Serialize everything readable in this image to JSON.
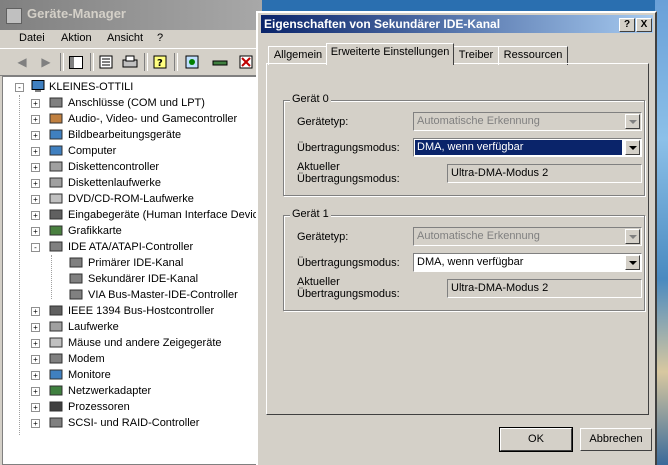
{
  "device_manager": {
    "title": "Geräte-Manager",
    "menu": [
      "Datei",
      "Aktion",
      "Ansicht",
      "?"
    ],
    "tree": {
      "root": "KLEINES-OTTILI",
      "items": [
        {
          "label": "Anschlüsse (COM und LPT)",
          "expand": "+",
          "level": 1
        },
        {
          "label": "Audio-, Video- und Gamecontroller",
          "expand": "+",
          "level": 1
        },
        {
          "label": "Bildbearbeitungsgeräte",
          "expand": "+",
          "level": 1
        },
        {
          "label": "Computer",
          "expand": "+",
          "level": 1
        },
        {
          "label": "Diskettencontroller",
          "expand": "+",
          "level": 1
        },
        {
          "label": "Diskettenlaufwerke",
          "expand": "+",
          "level": 1
        },
        {
          "label": "DVD/CD-ROM-Laufwerke",
          "expand": "+",
          "level": 1
        },
        {
          "label": "Eingabegeräte (Human Interface Devic",
          "expand": "+",
          "level": 1
        },
        {
          "label": "Grafikkarte",
          "expand": "+",
          "level": 1
        },
        {
          "label": "IDE ATA/ATAPI-Controller",
          "expand": "-",
          "level": 1
        },
        {
          "label": "Primärer IDE-Kanal",
          "expand": "",
          "level": 2
        },
        {
          "label": "Sekundärer IDE-Kanal",
          "expand": "",
          "level": 2
        },
        {
          "label": "VIA Bus-Master-IDE-Controller",
          "expand": "",
          "level": 2
        },
        {
          "label": "IEEE 1394 Bus-Hostcontroller",
          "expand": "+",
          "level": 1
        },
        {
          "label": "Laufwerke",
          "expand": "+",
          "level": 1
        },
        {
          "label": "Mäuse und andere Zeigegeräte",
          "expand": "+",
          "level": 1
        },
        {
          "label": "Modem",
          "expand": "+",
          "level": 1
        },
        {
          "label": "Monitore",
          "expand": "+",
          "level": 1
        },
        {
          "label": "Netzwerkadapter",
          "expand": "+",
          "level": 1
        },
        {
          "label": "Prozessoren",
          "expand": "+",
          "level": 1
        },
        {
          "label": "SCSI- und RAID-Controller",
          "expand": "+",
          "level": 1
        }
      ]
    }
  },
  "dialog": {
    "title": "Eigenschaften von Sekundärer IDE-Kanal",
    "help_btn": "?",
    "close_btn": "X",
    "tabs": [
      "Allgemein",
      "Erweiterte Einstellungen",
      "Treiber",
      "Ressourcen"
    ],
    "active_tab": "Erweiterte Einstellungen",
    "groups": [
      {
        "title": "Gerät 0",
        "device_type_label": "Gerätetyp:",
        "device_type_value": "Automatische Erkennung",
        "transfer_mode_label": "Übertragungsmodus:",
        "transfer_mode_value": "DMA, wenn verfügbar",
        "current_mode_label_1": "Aktueller",
        "current_mode_label_2": "Übertragungsmodus:",
        "current_mode_value": "Ultra-DMA-Modus 2"
      },
      {
        "title": "Gerät 1",
        "device_type_label": "Gerätetyp:",
        "device_type_value": "Automatische Erkennung",
        "transfer_mode_label": "Übertragungsmodus:",
        "transfer_mode_value": "DMA, wenn verfügbar",
        "current_mode_label_1": "Aktueller",
        "current_mode_label_2": "Übertragungsmodus:",
        "current_mode_value": "Ultra-DMA-Modus 2"
      }
    ],
    "ok_label": "OK",
    "cancel_label": "Abbrechen"
  }
}
